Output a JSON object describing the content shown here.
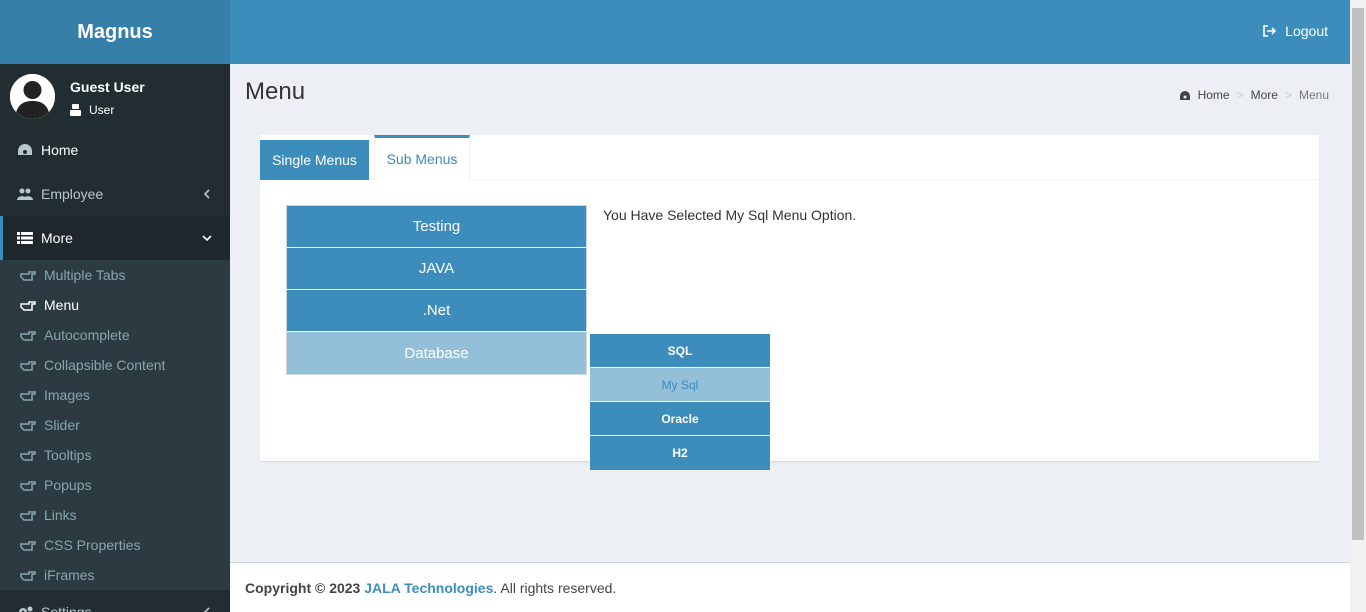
{
  "app": {
    "logo": "Magnus"
  },
  "user": {
    "name": "Guest User",
    "role": "User"
  },
  "sidebar": {
    "items": [
      {
        "label": "Home",
        "icon": "dashboard-icon"
      },
      {
        "label": "Employee",
        "icon": "users-icon"
      },
      {
        "label": "More",
        "icon": "list-icon"
      }
    ],
    "more_submenu": [
      "Multiple Tabs",
      "Menu",
      "Autocomplete",
      "Collapsible Content",
      "Images",
      "Slider",
      "Tooltips",
      "Popups",
      "Links",
      "CSS Properties",
      "iFrames"
    ],
    "next_item": "Settings"
  },
  "header": {
    "logout_label": "Logout"
  },
  "page": {
    "title": "Menu",
    "breadcrumb": [
      "Home",
      "More",
      "Menu"
    ]
  },
  "tabs": [
    {
      "label": "Single Menus"
    },
    {
      "label": "Sub Menus"
    }
  ],
  "menu": {
    "items": [
      "Testing",
      "JAVA",
      ".Net",
      "Database"
    ],
    "submenu": [
      "SQL",
      "My Sql",
      "Oracle",
      "H2"
    ],
    "selected_message": "You Have Selected My Sql Menu Option."
  },
  "footer": {
    "prefix": "Copyright © 2023",
    "company": "JALA Technologies",
    "suffix": ". All rights reserved."
  },
  "colors": {
    "accent": "#3c8dbc",
    "sidebar": "#222d32",
    "highlight": "#94bfd8"
  }
}
